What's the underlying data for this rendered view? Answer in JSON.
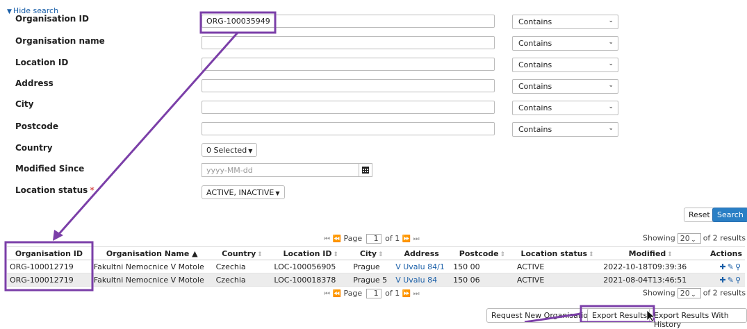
{
  "search": {
    "toggle_label": "Hide search",
    "fields": {
      "org_id": {
        "label": "Organisation ID",
        "value": "ORG-100035949",
        "operator": "Contains"
      },
      "org_name": {
        "label": "Organisation name",
        "value": "",
        "operator": "Contains"
      },
      "location_id": {
        "label": "Location ID",
        "value": "",
        "operator": "Contains"
      },
      "address": {
        "label": "Address",
        "value": "",
        "operator": "Contains"
      },
      "city": {
        "label": "City",
        "value": "",
        "operator": "Contains"
      },
      "postcode": {
        "label": "Postcode",
        "value": "",
        "operator": "Contains"
      },
      "country": {
        "label": "Country",
        "value": "0 Selected"
      },
      "modified_since": {
        "label": "Modified Since",
        "placeholder": "yyyy-MM-dd"
      },
      "location_status": {
        "label": "Location status",
        "required_marker": "*",
        "value": "ACTIVE, INACTIVE"
      }
    },
    "reset_label": "Reset",
    "search_label": "Search"
  },
  "pagination": {
    "page_label": "Page",
    "page": "1",
    "of_label": "of 1",
    "showing_label": "Showing",
    "page_size": "20",
    "results_label": "of 2 results"
  },
  "table": {
    "headers": {
      "org_id": "Organisation ID",
      "org_name": "Organisation Name ▲",
      "country": "Country",
      "location_id": "Location ID",
      "city": "City",
      "address": "Address",
      "postcode": "Postcode",
      "location_status": "Location status",
      "modified": "Modified",
      "actions": "Actions"
    },
    "rows": [
      {
        "org_id": "ORG-100012719",
        "org_name": "Fakultni Nemocnice V Motole",
        "country": "Czechia",
        "location_id": "LOC-100056905",
        "city": "Prague",
        "address": "V Uvalu 84/1",
        "postcode": "150 00",
        "location_status": "ACTIVE",
        "modified": "2022-10-18T09:39:36"
      },
      {
        "org_id": "ORG-100012719",
        "org_name": "Fakultni Nemocnice V Motole",
        "country": "Czechia",
        "location_id": "LOC-100018378",
        "city": "Prague 5",
        "address": "V Uvalu 84",
        "postcode": "150 06",
        "location_status": "ACTIVE",
        "modified": "2021-08-04T13:46:51"
      }
    ]
  },
  "footer_buttons": {
    "request_new": "Request New Organisation",
    "export_results": "Export Results",
    "export_history": "Export Results With History"
  },
  "colors": {
    "accent": "#2a7fc5",
    "link": "#1a5fa8",
    "annotation": "#7b3fa8",
    "required": "#d9534f"
  },
  "icons": [
    "caret-down-icon",
    "calendar-icon",
    "sort-icon",
    "first-page-icon",
    "prev-page-icon",
    "next-page-icon",
    "last-page-icon",
    "add-icon",
    "edit-icon",
    "view-icon",
    "cursor-icon"
  ]
}
